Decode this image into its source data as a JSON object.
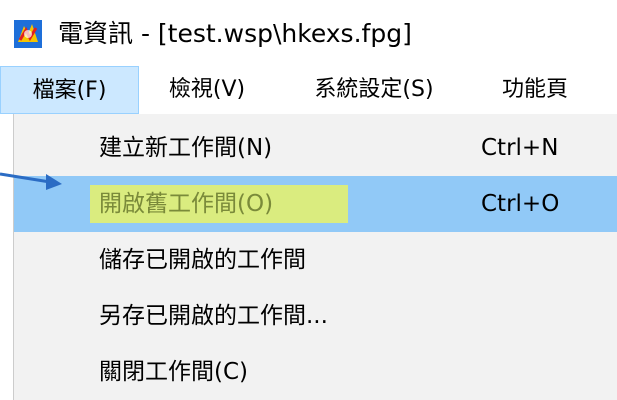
{
  "window": {
    "title": "電資訊 - [test.wsp\\hkexs.fpg]",
    "icon": "app-icon"
  },
  "menubar": {
    "items": [
      {
        "label": "檔案(F)",
        "active": true
      },
      {
        "label": "檢視(V)",
        "active": false
      },
      {
        "label": "系統設定(S)",
        "active": false
      },
      {
        "label": "功能頁",
        "active": false
      }
    ]
  },
  "file_menu": {
    "items": [
      {
        "label": "建立新工作間(N)",
        "shortcut": "Ctrl+N",
        "highlighted": false
      },
      {
        "label": "開啟舊工作間(O)",
        "shortcut": "Ctrl+O",
        "highlighted": true
      },
      {
        "label": "儲存已開啟的工作間",
        "shortcut": "",
        "highlighted": false
      },
      {
        "label": "另存已開啟的工作間...",
        "shortcut": "",
        "highlighted": false
      },
      {
        "label": "關閉工作間(C)",
        "shortcut": "",
        "highlighted": false
      }
    ]
  },
  "colors": {
    "menu_active_bg": "#cce8ff",
    "dropdown_bg": "#f2f2f2",
    "item_highlight_bg": "#91c9f7",
    "text_marker": "#e6f26a",
    "annotation_arrow": "#2b6cc4"
  }
}
